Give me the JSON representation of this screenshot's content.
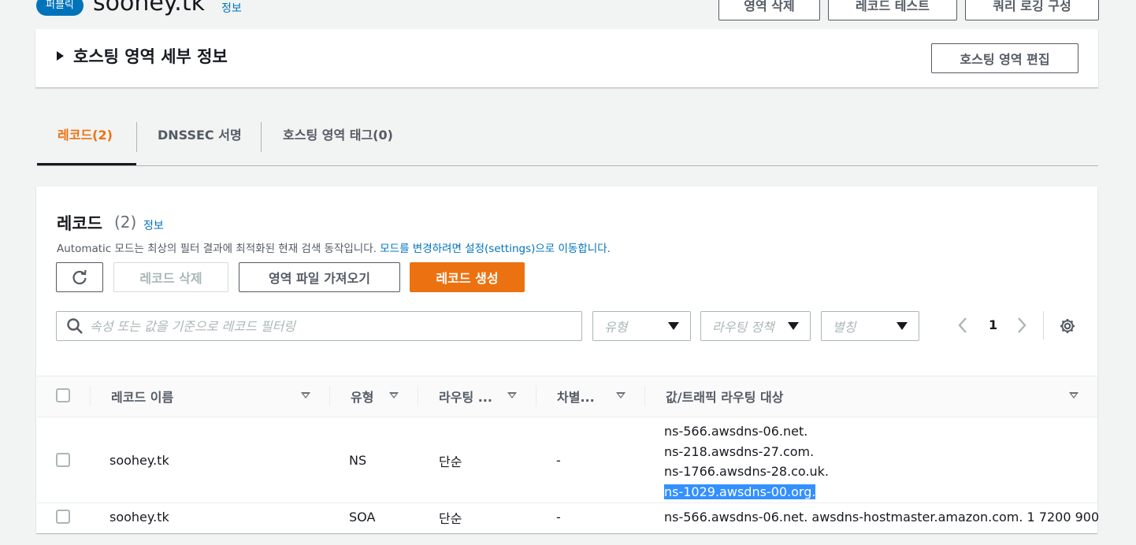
{
  "header": {
    "badge": "퍼블릭",
    "zone_name": "soohey.tk",
    "info": "정보",
    "buttons": [
      "영역 삭제",
      "레코드 테스트",
      "쿼리 로깅 구성"
    ]
  },
  "details": {
    "title": "호스팅 영역 세부 정보",
    "edit_button": "호스팅 영역 편집"
  },
  "tabs": [
    {
      "label": "레코드(2)",
      "active": true
    },
    {
      "label": "DNSSEC 서명",
      "active": false
    },
    {
      "label": "호스팅 영역 태그(0)",
      "active": false
    }
  ],
  "records": {
    "title": "레코드",
    "count": "(2)",
    "info": "정보",
    "description": "Automatic 모드는 최상의 필터 결과에 최적화된 현재 검색 동작입니다.",
    "description_link": "모드를 변경하려면 설정(settings)으로 이동합니다.",
    "buttons": {
      "delete": "레코드 삭제",
      "import": "영역 파일 가져오기",
      "create": "레코드 생성"
    },
    "filter_placeholder": "속성 또는 값을 기준으로 레코드 필터링",
    "selects": [
      "유형",
      "라우팅 정책",
      "별칭"
    ],
    "page": "1",
    "columns": [
      "레코드 이름",
      "유형",
      "라우팅 ...",
      "차별...",
      "값/트래픽 라우팅 대상"
    ],
    "rows": [
      {
        "name": "soohey.tk",
        "type": "NS",
        "routing": "단순",
        "diff": "-",
        "values": [
          "ns-566.awsdns-06.net.",
          "ns-218.awsdns-27.com.",
          "ns-1766.awsdns-28.co.uk.",
          "ns-1029.awsdns-00.org."
        ]
      },
      {
        "name": "soohey.tk",
        "type": "SOA",
        "routing": "단순",
        "diff": "-",
        "values": [
          "ns-566.awsdns-06.net. awsdns-hostmaster.amazon.com. 1 7200 900"
        ]
      }
    ]
  },
  "colors": {
    "accent": "#ec7211",
    "link": "#0073bb",
    "selection": "#3390ff"
  }
}
